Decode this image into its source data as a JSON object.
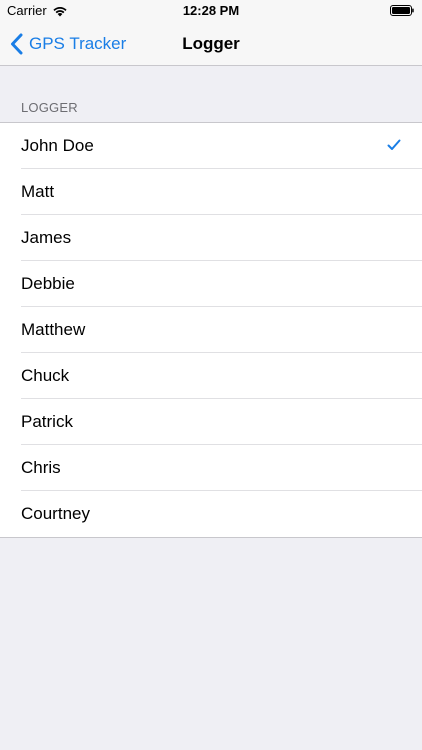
{
  "status_bar": {
    "carrier": "Carrier",
    "time": "12:28 PM",
    "wifi_icon": "wifi-icon",
    "battery_icon": "battery-icon"
  },
  "nav": {
    "back_label": "GPS Tracker",
    "title": "Logger"
  },
  "section": {
    "header": "LOGGER"
  },
  "loggers": {
    "selected_index": 0,
    "items": [
      {
        "label": "John Doe",
        "selected": true
      },
      {
        "label": "Matt",
        "selected": false
      },
      {
        "label": "James",
        "selected": false
      },
      {
        "label": "Debbie",
        "selected": false
      },
      {
        "label": "Matthew",
        "selected": false
      },
      {
        "label": "Chuck",
        "selected": false
      },
      {
        "label": "Patrick",
        "selected": false
      },
      {
        "label": "Chris",
        "selected": false
      },
      {
        "label": "Courtney",
        "selected": false
      }
    ]
  },
  "colors": {
    "accent": "#1a7ee6",
    "background": "#efeff4",
    "separator": "#c8c7cc"
  }
}
